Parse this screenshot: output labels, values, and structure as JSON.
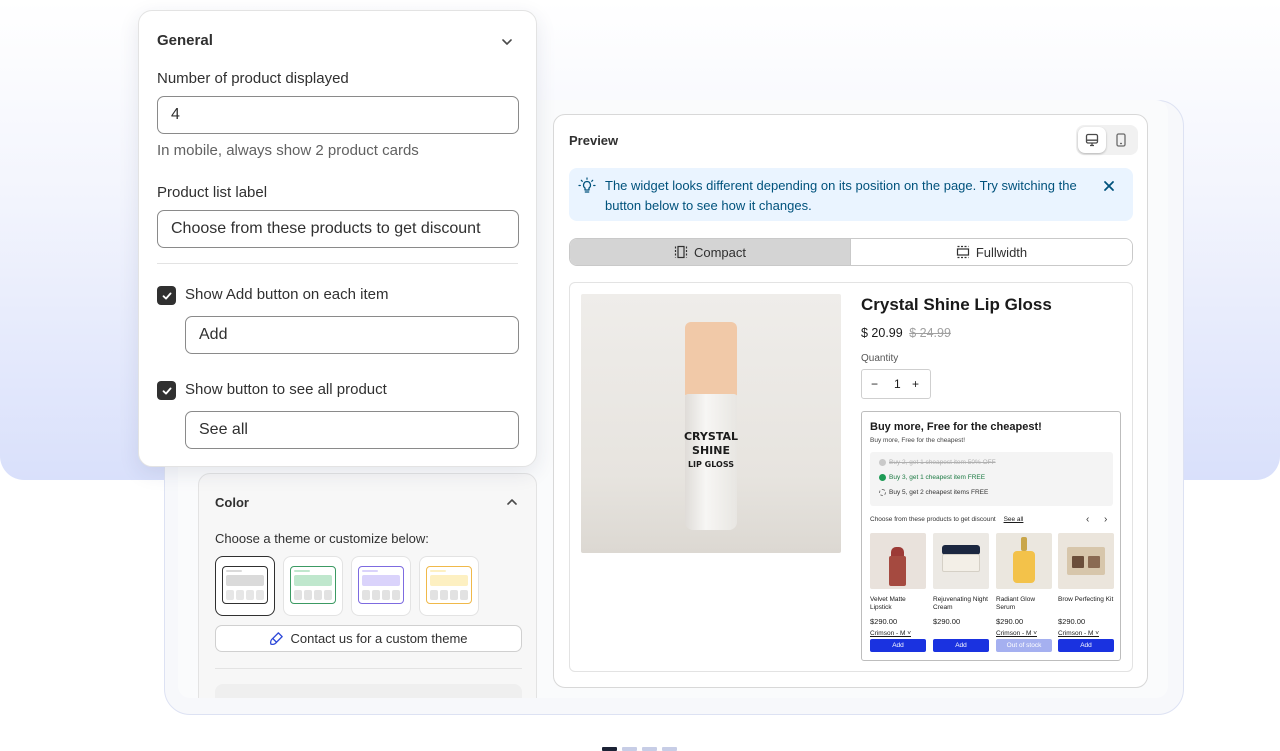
{
  "general": {
    "title": "General",
    "num_label": "Number of product displayed",
    "num_value": "4",
    "num_help": "In mobile, always show 2 product cards",
    "list_label": "Product list label",
    "list_value": "Choose from these products to get discount",
    "show_add_label": "Show Add button on each item",
    "show_add_checked": true,
    "add_value": "Add",
    "show_all_label": "Show button to see all product",
    "show_all_checked": true,
    "see_all_value": "See all"
  },
  "color": {
    "title": "Color",
    "subtitle": "Choose a theme or customize below:",
    "themes": [
      {
        "name": "gray",
        "accent": "#dadada",
        "border": "#303030",
        "selected": true
      },
      {
        "name": "green",
        "accent": "#bfe7cd",
        "border": "#3c9a63",
        "selected": false
      },
      {
        "name": "purple",
        "accent": "#dad3fb",
        "border": "#7d6be0",
        "selected": false
      },
      {
        "name": "yellow",
        "accent": "#fdf0c2",
        "border": "#f0b94a",
        "selected": false
      }
    ],
    "contact_button": "Contact us for a custom theme"
  },
  "preview": {
    "title": "Preview",
    "banner": "The widget looks different depending on its position on the page. Try switching the button below to see how it changes.",
    "tab_compact": "Compact",
    "tab_fullwidth": "Fullwidth",
    "product": {
      "name": "Crystal Shine Lip Gloss",
      "price": "$ 20.99",
      "old_price": "$ 24.99",
      "quantity_label": "Quantity",
      "quantity": "1",
      "bottle_line1": "CRYSTAL",
      "bottle_line2": "SHINE",
      "bottle_line3": "LIP GLOSS"
    },
    "bundle": {
      "title": "Buy more, Free for the cheapest!",
      "subtitle": "Buy more, Free for the cheapest!",
      "tiers": [
        {
          "text": "Buy 2, get 1 cheapest item 50% OFF",
          "state": "disabled"
        },
        {
          "text": "Buy 3, get 1 cheapest item FREE",
          "state": "active"
        },
        {
          "text": "Buy 5, get 2 cheapest items FREE",
          "state": "pending"
        }
      ],
      "list_label": "Choose from these products to get discount",
      "see_all": "See all",
      "items": [
        {
          "name": "Velvet Matte Lipstick",
          "price": "$290.00",
          "variant": "Crimson - M",
          "button": "Add",
          "button_color": "#1a32e0"
        },
        {
          "name": "Rejuvenating Night Cream",
          "price": "$290.00",
          "variant": "",
          "button": "Add",
          "button_color": "#1a32e0"
        },
        {
          "name": "Radiant Glow Serum",
          "price": "$290.00",
          "variant": "Crimson - M",
          "button": "Out of stock",
          "button_color": "#a5b0f0"
        },
        {
          "name": "Brow Perfecting Kit",
          "price": "$290.00",
          "variant": "Crimson - M",
          "button": "Add",
          "button_color": "#1a32e0"
        }
      ]
    }
  },
  "pagination": {
    "total": 4,
    "active": 1
  }
}
